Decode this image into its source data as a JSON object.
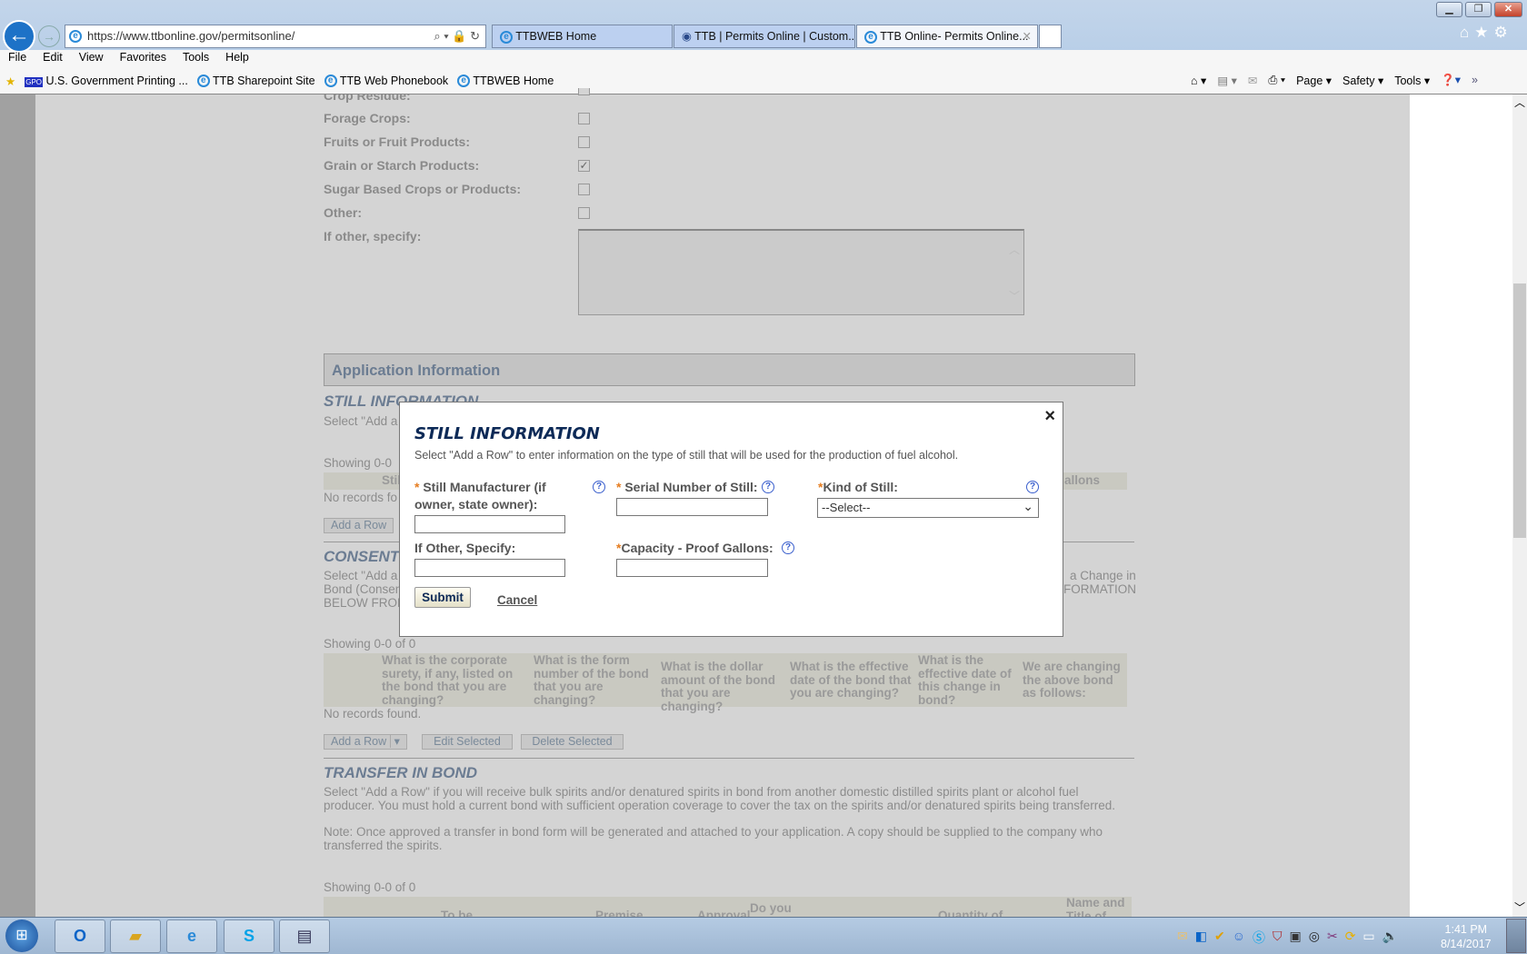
{
  "browser": {
    "url": "https://www.ttbonline.gov/permitsonline/",
    "tabs": [
      {
        "label": "TTBWEB Home"
      },
      {
        "label": "TTB | Permits Online | Custom..."
      },
      {
        "label": "TTB Online- Permits Online..."
      }
    ],
    "menu": [
      "File",
      "Edit",
      "View",
      "Favorites",
      "Tools",
      "Help"
    ],
    "favorites": [
      "U.S. Government Printing ...",
      "TTB Sharepoint Site",
      "TTB Web Phonebook",
      "TTBWEB Home"
    ],
    "gpo_logo": "GPO",
    "commands": [
      "Page",
      "Safety",
      "Tools"
    ]
  },
  "form": {
    "crop_residue": "Crop Residue:",
    "rows": [
      {
        "label": "Forage Crops:",
        "checked": false
      },
      {
        "label": "Fruits or Fruit Products:",
        "checked": false
      },
      {
        "label": "Grain or Starch Products:",
        "checked": true
      },
      {
        "label": "Sugar Based Crops or Products:",
        "checked": false
      },
      {
        "label": "Other:",
        "checked": false
      }
    ],
    "check_mark": "✓",
    "specify_label": "If other, specify:",
    "app_info": "Application Information"
  },
  "still_bg": {
    "heading": "STILL INFORMATION",
    "text": "Select \"Add a F",
    "showing": "Showing 0-0",
    "col_left": "Stil",
    "col_right": "allons",
    "none": "No records fo",
    "add": "Add a Row"
  },
  "consent": {
    "heading": "CONSENT",
    "left_lines": [
      "Select \"Add a F",
      "Bond (Consent",
      "BELOW FROM"
    ],
    "right_lines": [
      "a Change in",
      "FORMATION"
    ],
    "showing": "Showing 0-0 of 0",
    "columns": [
      "What is the corporate surety, if any, listed on the bond that you are changing?",
      "What is the form number of the bond that you are changing?",
      "What is the dollar amount of the bond that you are changing?",
      "What is the effective date of the bond that you are changing?",
      "What is the effective date of this change in bond?",
      "We are changing the above bond as follows:"
    ],
    "none": "No records found.",
    "buttons": {
      "add": "Add a Row",
      "edit": "Edit Selected",
      "delete": "Delete Selected"
    }
  },
  "transfer": {
    "heading": "TRANSFER IN BOND",
    "text1": "Select \"Add a Row\" if you will receive bulk spirits and/or denatured spirits in bond from another domestic distilled spirits plant or alcohol fuel producer. You must hold a current bond with sufficient operation coverage to cover the tax on the spirits and/or denatured spirits being transferred.",
    "text2": "Note: Once approved a transfer in bond form will be generated and attached to your application. A copy should be supplied to the company who transferred the spirits.",
    "showing": "Showing 0-0 of 0",
    "columns": [
      "To be",
      "Premise",
      "Approval",
      "Do you",
      "Quantity of",
      "Name and Title of"
    ]
  },
  "modal": {
    "title": "STILL INFORMATION",
    "description": "Select \"Add a Row\" to enter information on the type of still that will be used for the production of fuel alcohol.",
    "close": "×",
    "manufacturer_label": "Still Manufacturer (if owner, state owner):",
    "serial_label": "Serial Number of Still:",
    "kind_label": "Kind of Still:",
    "kind_value": "--Select--",
    "other_label": "If Other, Specify:",
    "capacity_label": "Capacity - Proof Gallons:",
    "required_mark": "*",
    "help": "?",
    "submit": "Submit",
    "cancel": "Cancel"
  },
  "clock": {
    "time": "1:41 PM",
    "date": "8/14/2017"
  }
}
